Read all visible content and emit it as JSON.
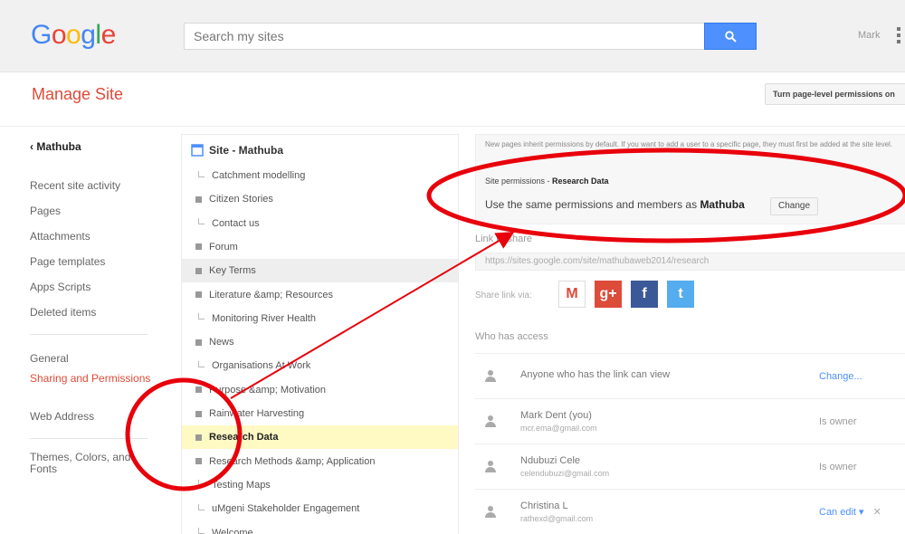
{
  "header": {
    "logo_letters": [
      {
        "ch": "G",
        "color": "#4285f4"
      },
      {
        "ch": "o",
        "color": "#ea4335"
      },
      {
        "ch": "o",
        "color": "#fbbc05"
      },
      {
        "ch": "g",
        "color": "#4285f4"
      },
      {
        "ch": "l",
        "color": "#34a853"
      },
      {
        "ch": "e",
        "color": "#ea4335"
      }
    ],
    "search_placeholder": "Search my sites",
    "search_icon": "search-icon",
    "user_name": "Mark",
    "apps_icon": "more-vert-icon"
  },
  "manage": {
    "title": "Manage Site",
    "toggle_button": "Turn page-level permissions on"
  },
  "leftnav": {
    "back": "‹ Mathuba",
    "group1": [
      "Recent site activity",
      "Pages",
      "Attachments",
      "Page templates",
      "Apps Scripts",
      "Deleted items"
    ],
    "group2": [
      "General",
      "Sharing and Permissions",
      "Web Address"
    ],
    "group3": [
      "Themes, Colors, and Fonts"
    ]
  },
  "tree": {
    "root": "Site - Mathuba",
    "items": [
      {
        "label": "Catchment modelling",
        "kind": "leaf",
        "hl": ""
      },
      {
        "label": "Citizen Stories",
        "kind": "folder",
        "hl": ""
      },
      {
        "label": "Contact us",
        "kind": "leaf",
        "hl": ""
      },
      {
        "label": "Forum",
        "kind": "folder",
        "hl": ""
      },
      {
        "label": "Key Terms",
        "kind": "folder",
        "hl": "gray"
      },
      {
        "label": "Literature &amp; Resources",
        "kind": "folder",
        "hl": ""
      },
      {
        "label": "Monitoring River Health",
        "kind": "leaf",
        "hl": ""
      },
      {
        "label": "News",
        "kind": "folder",
        "hl": ""
      },
      {
        "label": "Organisations At Work",
        "kind": "leaf",
        "hl": ""
      },
      {
        "label": "Purpose &amp; Motivation",
        "kind": "folder",
        "hl": ""
      },
      {
        "label": "Rainwater Harvesting",
        "kind": "folder",
        "hl": ""
      },
      {
        "label": "Research Data",
        "kind": "folder",
        "hl": "yellow"
      },
      {
        "label": "Research Methods &amp; Application",
        "kind": "folder",
        "hl": ""
      },
      {
        "label": "Testing Maps",
        "kind": "leaf",
        "hl": ""
      },
      {
        "label": "uMgeni Stakeholder Engagement",
        "kind": "leaf",
        "hl": ""
      },
      {
        "label": "Welcome",
        "kind": "leaf",
        "hl": ""
      }
    ]
  },
  "right": {
    "notice": "New pages inherit permissions by default. If you want to add a user to a specific page, they must first be added at the site level.",
    "site_perm_prefix": "Site permissions - ",
    "site_perm_page": "Research Data",
    "same_prefix": "Use the same permissions and members as ",
    "same_site": "Mathuba",
    "change": "Change",
    "link_label": "Link to share",
    "link_url": "https://sites.google.com/site/mathubaweb2014/research",
    "share_label": "Share link via:",
    "share_icons": [
      "gmail-icon",
      "google-plus-icon",
      "facebook-icon",
      "twitter-icon"
    ],
    "who_label": "Who has access",
    "access": [
      {
        "name": "Anyone who has the link can view",
        "email": "",
        "perm": "Change...",
        "link": true,
        "x": false
      },
      {
        "name": "Mark Dent (you)",
        "email": "mcr.ema@gmail.com",
        "perm": "Is owner",
        "link": false,
        "x": false
      },
      {
        "name": "Ndubuzi Cele",
        "email": "celendubuzi@gmail.com",
        "perm": "Is owner",
        "link": false,
        "x": false
      },
      {
        "name": "Christina L",
        "email": "rathexd@gmail.com",
        "perm": "Can edit ▾",
        "link": true,
        "x": true
      }
    ]
  },
  "annotation_colors": {
    "circle": "#e8000b",
    "arrow": "#e8000b"
  }
}
